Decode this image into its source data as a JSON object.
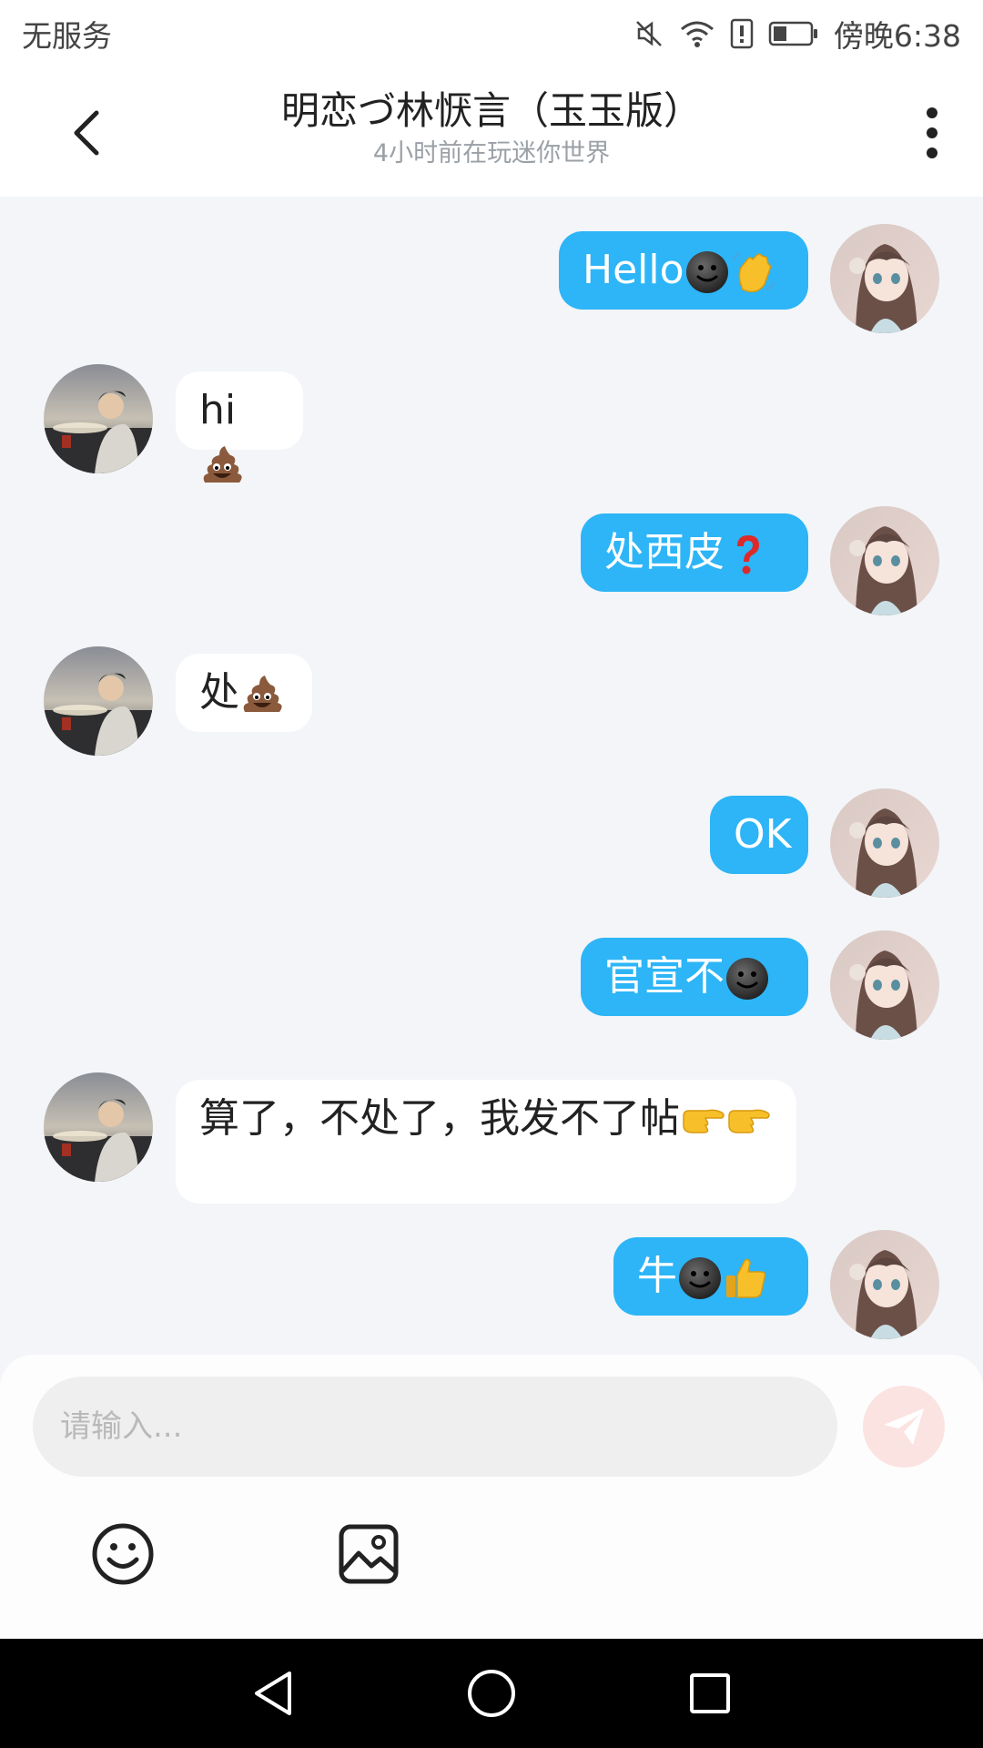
{
  "status_bar": {
    "carrier": "无服务",
    "time": "傍晚6:38",
    "icons": [
      "mute-icon",
      "wifi-icon",
      "alert-icon",
      "battery-icon"
    ]
  },
  "header": {
    "title": "明恋づ林恹言（玉玉版）",
    "subtitle": "4小时前在玩迷你世界",
    "back_icon": "chevron-left-icon",
    "more_icon": "more-vertical-icon"
  },
  "messages": [
    {
      "from": "me",
      "text": "Hello",
      "emojis": [
        "dark-smile",
        "wave"
      ]
    },
    {
      "from": "them",
      "text": "hi",
      "emojis": [
        "poop"
      ]
    },
    {
      "from": "me",
      "text": "处西皮",
      "emojis": [
        "red-question"
      ]
    },
    {
      "from": "them",
      "text": "处",
      "emojis": [
        "poop"
      ]
    },
    {
      "from": "me",
      "text": "OK",
      "emojis": []
    },
    {
      "from": "me",
      "text": "官宣不",
      "emojis": [
        "dark-smile"
      ]
    },
    {
      "from": "them",
      "text": "算了，不处了，我发不了帖",
      "emojis": [
        "point-right",
        "point-right"
      ]
    },
    {
      "from": "me",
      "text": "牛",
      "emojis": [
        "dark-smile",
        "thumbs-up"
      ]
    }
  ],
  "input": {
    "placeholder": "请输入...",
    "send_icon": "send-icon"
  },
  "toolbar": {
    "emoji_icon": "smiley-icon",
    "image_icon": "image-icon"
  },
  "nav_bar": {
    "icons": [
      "nav-back-icon",
      "nav-home-icon",
      "nav-recent-icon"
    ]
  },
  "colors": {
    "my_bubble": "#2db5f7",
    "their_bubble": "#ffffff",
    "chat_background": "#f3f5f8",
    "send_button": "#fbe3e1"
  }
}
